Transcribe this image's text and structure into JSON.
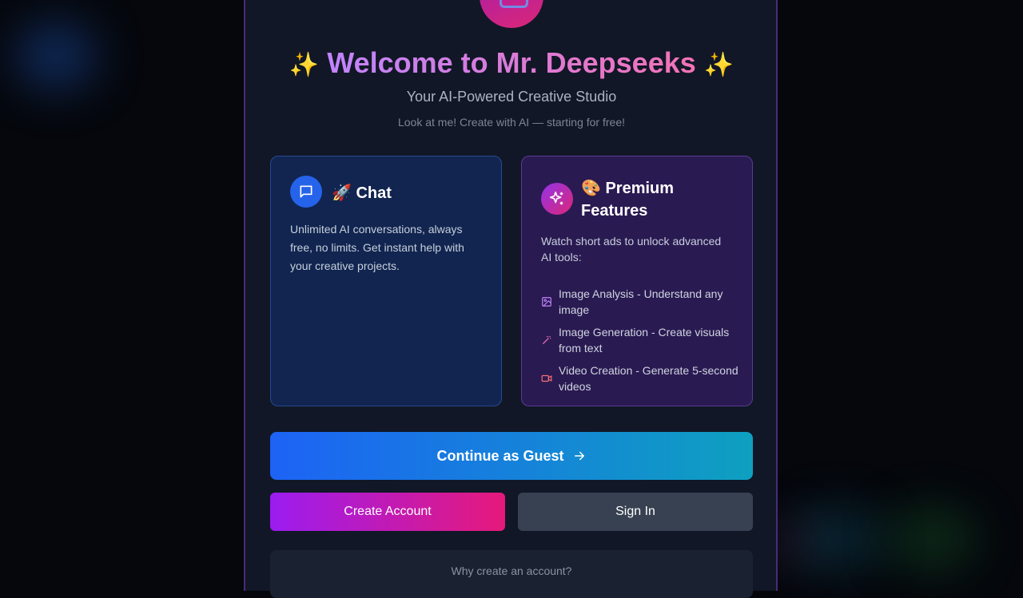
{
  "welcome": {
    "spark_left": "✨",
    "title": "Welcome to Mr. Deepseeks",
    "spark_right": "✨",
    "subtitle": "Your AI-Powered Creative Studio",
    "tagline": "Look at me! Create with AI — starting for free!"
  },
  "cards": {
    "chat": {
      "icon": "message-square-icon",
      "title": "🚀 Chat",
      "description": "Unlimited AI conversations, always free, no limits. Get instant help with your creative projects."
    },
    "premium": {
      "icon": "sparkles-icon",
      "title": "🎨 Premium Features",
      "description": "Watch short ads to unlock advanced AI tools:",
      "features": [
        {
          "icon": "image-icon",
          "label": "Image Analysis - Understand any image"
        },
        {
          "icon": "wand-icon",
          "label": "Image Generation - Create visuals from text"
        },
        {
          "icon": "video-icon",
          "label": "Video Creation - Generate 5-second videos"
        }
      ]
    }
  },
  "actions": {
    "guest_label": "Continue as Guest",
    "create_label": "Create Account",
    "signin_label": "Sign In"
  },
  "why_account": "Why create an account?",
  "colors": {
    "accent_blue": "#1d63f5",
    "accent_pink": "#e6197a",
    "accent_purple": "#9b1cf0",
    "panel_bg": "#111726"
  }
}
